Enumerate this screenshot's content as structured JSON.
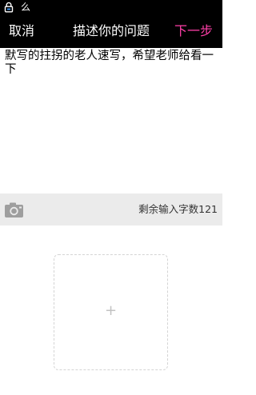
{
  "status_bar": {
    "label": "么"
  },
  "header": {
    "cancel_label": "取消",
    "title": "描述你的问题",
    "next_label": "下一步",
    "next_color": "#ff3fa8"
  },
  "question": {
    "value": "默写的拄拐的老人速写，希望老师给看一下"
  },
  "toolbar": {
    "camera_icon": "camera-icon",
    "char_counter": "剩余输入字数121"
  },
  "add_photo": {
    "plus_glyph": "+"
  }
}
